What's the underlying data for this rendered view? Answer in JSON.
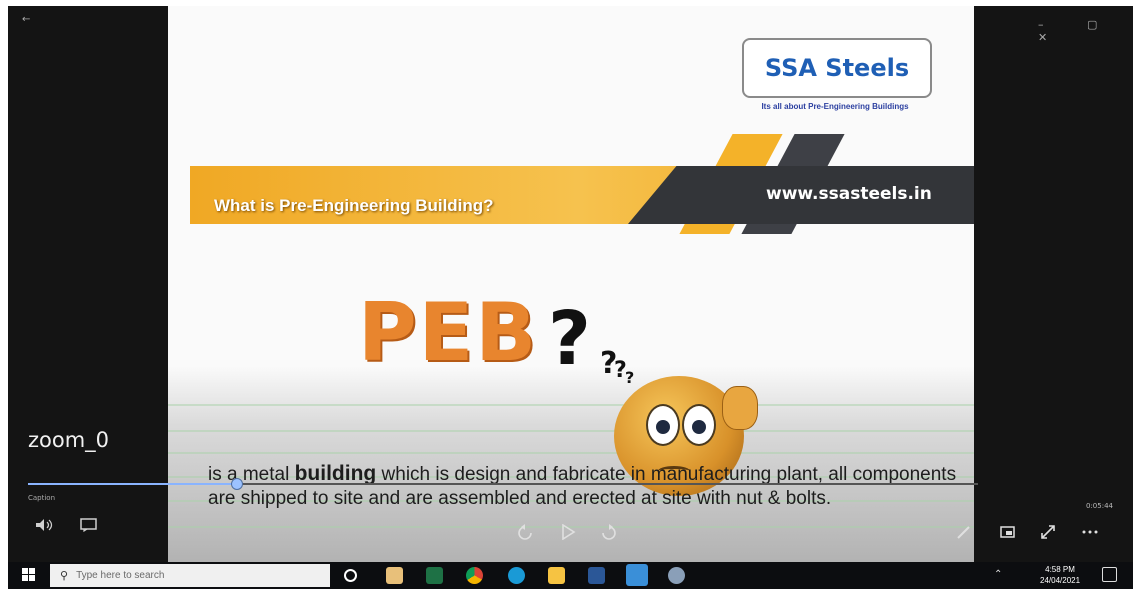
{
  "player": {
    "title": "zoom_0",
    "caption_label": "Caption",
    "time": "0:05:44",
    "back_glyph": "←",
    "window_controls": "–  ▢  ✕",
    "progress_fraction": 0.22
  },
  "slide": {
    "logo": "SSA Steels",
    "tagline": "Its all about Pre-Engineering Buildings",
    "banner_title": "What is Pre-Engineering Building?",
    "banner_url": "www.ssasteels.in",
    "peb": "PEB",
    "question_mark": "?",
    "body_pre": "is a metal ",
    "body_bold": "building",
    "body_rest": " which is design and fabricate in manufacturing plant, all components are shipped to site and are assembled and erected at site with nut & bolts."
  },
  "taskbar": {
    "search_placeholder": "Type here to search",
    "clock_time": "4:58 PM",
    "clock_date": "24/04/2021",
    "icons": [
      "start-icon",
      "cortana-icon",
      "store-icon",
      "excel-icon",
      "chrome-icon",
      "edge-icon",
      "file-explorer-icon",
      "word-icon",
      "photos-icon",
      "media-icon"
    ]
  },
  "colors": {
    "banner_orange": "#f0a824",
    "banner_dark": "#333539",
    "logo_blue": "#1f5fb5",
    "peb_orange": "#e8852e",
    "seek_blue": "#8ab4ff"
  }
}
